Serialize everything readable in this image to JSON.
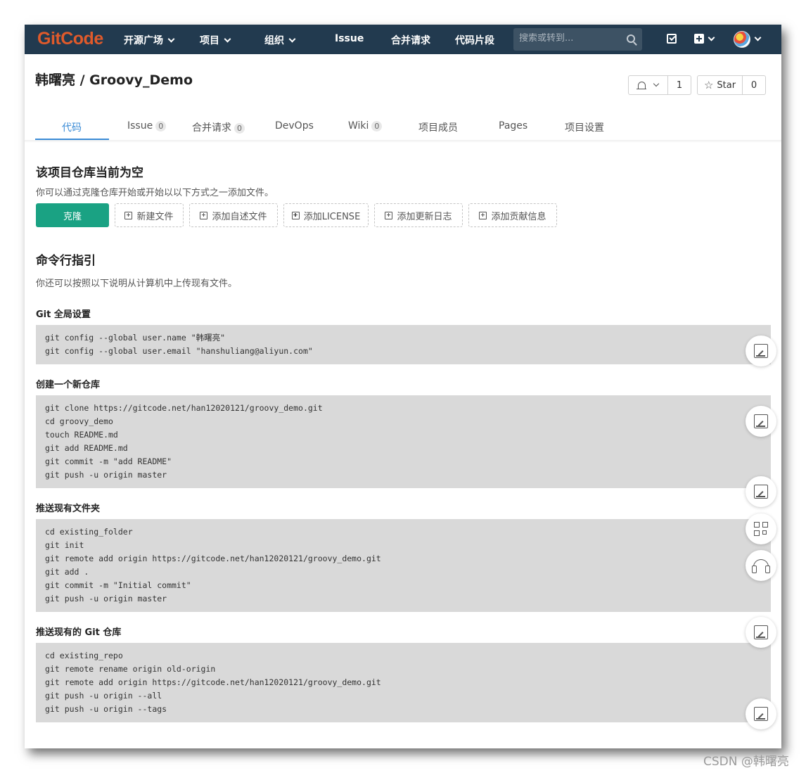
{
  "navbar": {
    "logo": "GitCode",
    "items": [
      "开源广场",
      "项目",
      "组织",
      "Issue",
      "合并请求",
      "代码片段"
    ],
    "search_placeholder": "搜索或转到..."
  },
  "header": {
    "repo_title": "韩曙亮 / Groovy_Demo",
    "watch_count": "1",
    "star_label": "Star",
    "star_count": "0"
  },
  "tabs": [
    {
      "label": "代码"
    },
    {
      "label": "Issue",
      "badge": "0"
    },
    {
      "label": "合并请求",
      "badge": "0"
    },
    {
      "label": "DevOps"
    },
    {
      "label": "Wiki",
      "badge": "0"
    },
    {
      "label": "项目成员"
    },
    {
      "label": "Pages"
    },
    {
      "label": "项目设置"
    }
  ],
  "empty_repo": {
    "title": "该项目仓库当前为空",
    "description": "你可以通过克隆仓库开始或开始以以下方式之一添加文件。",
    "clone_label": "克隆",
    "actions": [
      "新建文件",
      "添加自述文件",
      "添加LICENSE",
      "添加更新日志",
      "添加贡献信息"
    ]
  },
  "cli": {
    "title": "命令行指引",
    "description": "你还可以按照以下说明从计算机中上传现有文件。",
    "sections": [
      {
        "title": "Git 全局设置",
        "code": "git config --global user.name \"韩曙亮\"\ngit config --global user.email \"hanshuliang@aliyun.com\""
      },
      {
        "title": "创建一个新仓库",
        "code": "git clone https://gitcode.net/han12020121/groovy_demo.git\ncd groovy_demo\ntouch README.md\ngit add README.md\ngit commit -m \"add README\"\ngit push -u origin master"
      },
      {
        "title": "推送现有文件夹",
        "code": "cd existing_folder\ngit init\ngit remote add origin https://gitcode.net/han12020121/groovy_demo.git\ngit add .\ngit commit -m \"Initial commit\"\ngit push -u origin master"
      },
      {
        "title": "推送现有的 Git 仓库",
        "code": "cd existing_repo\ngit remote rename origin old-origin\ngit remote add origin https://gitcode.net/han12020121/groovy_demo.git\ngit push -u origin --all\ngit push -u origin --tags"
      }
    ]
  },
  "watermark": "CSDN @韩曙亮",
  "colors": {
    "navbar": "#223a4f",
    "logo": "#e05a2b",
    "accent": "#3a8bd6",
    "clone_button": "#1aa283",
    "code_background": "#d9d9d9"
  }
}
